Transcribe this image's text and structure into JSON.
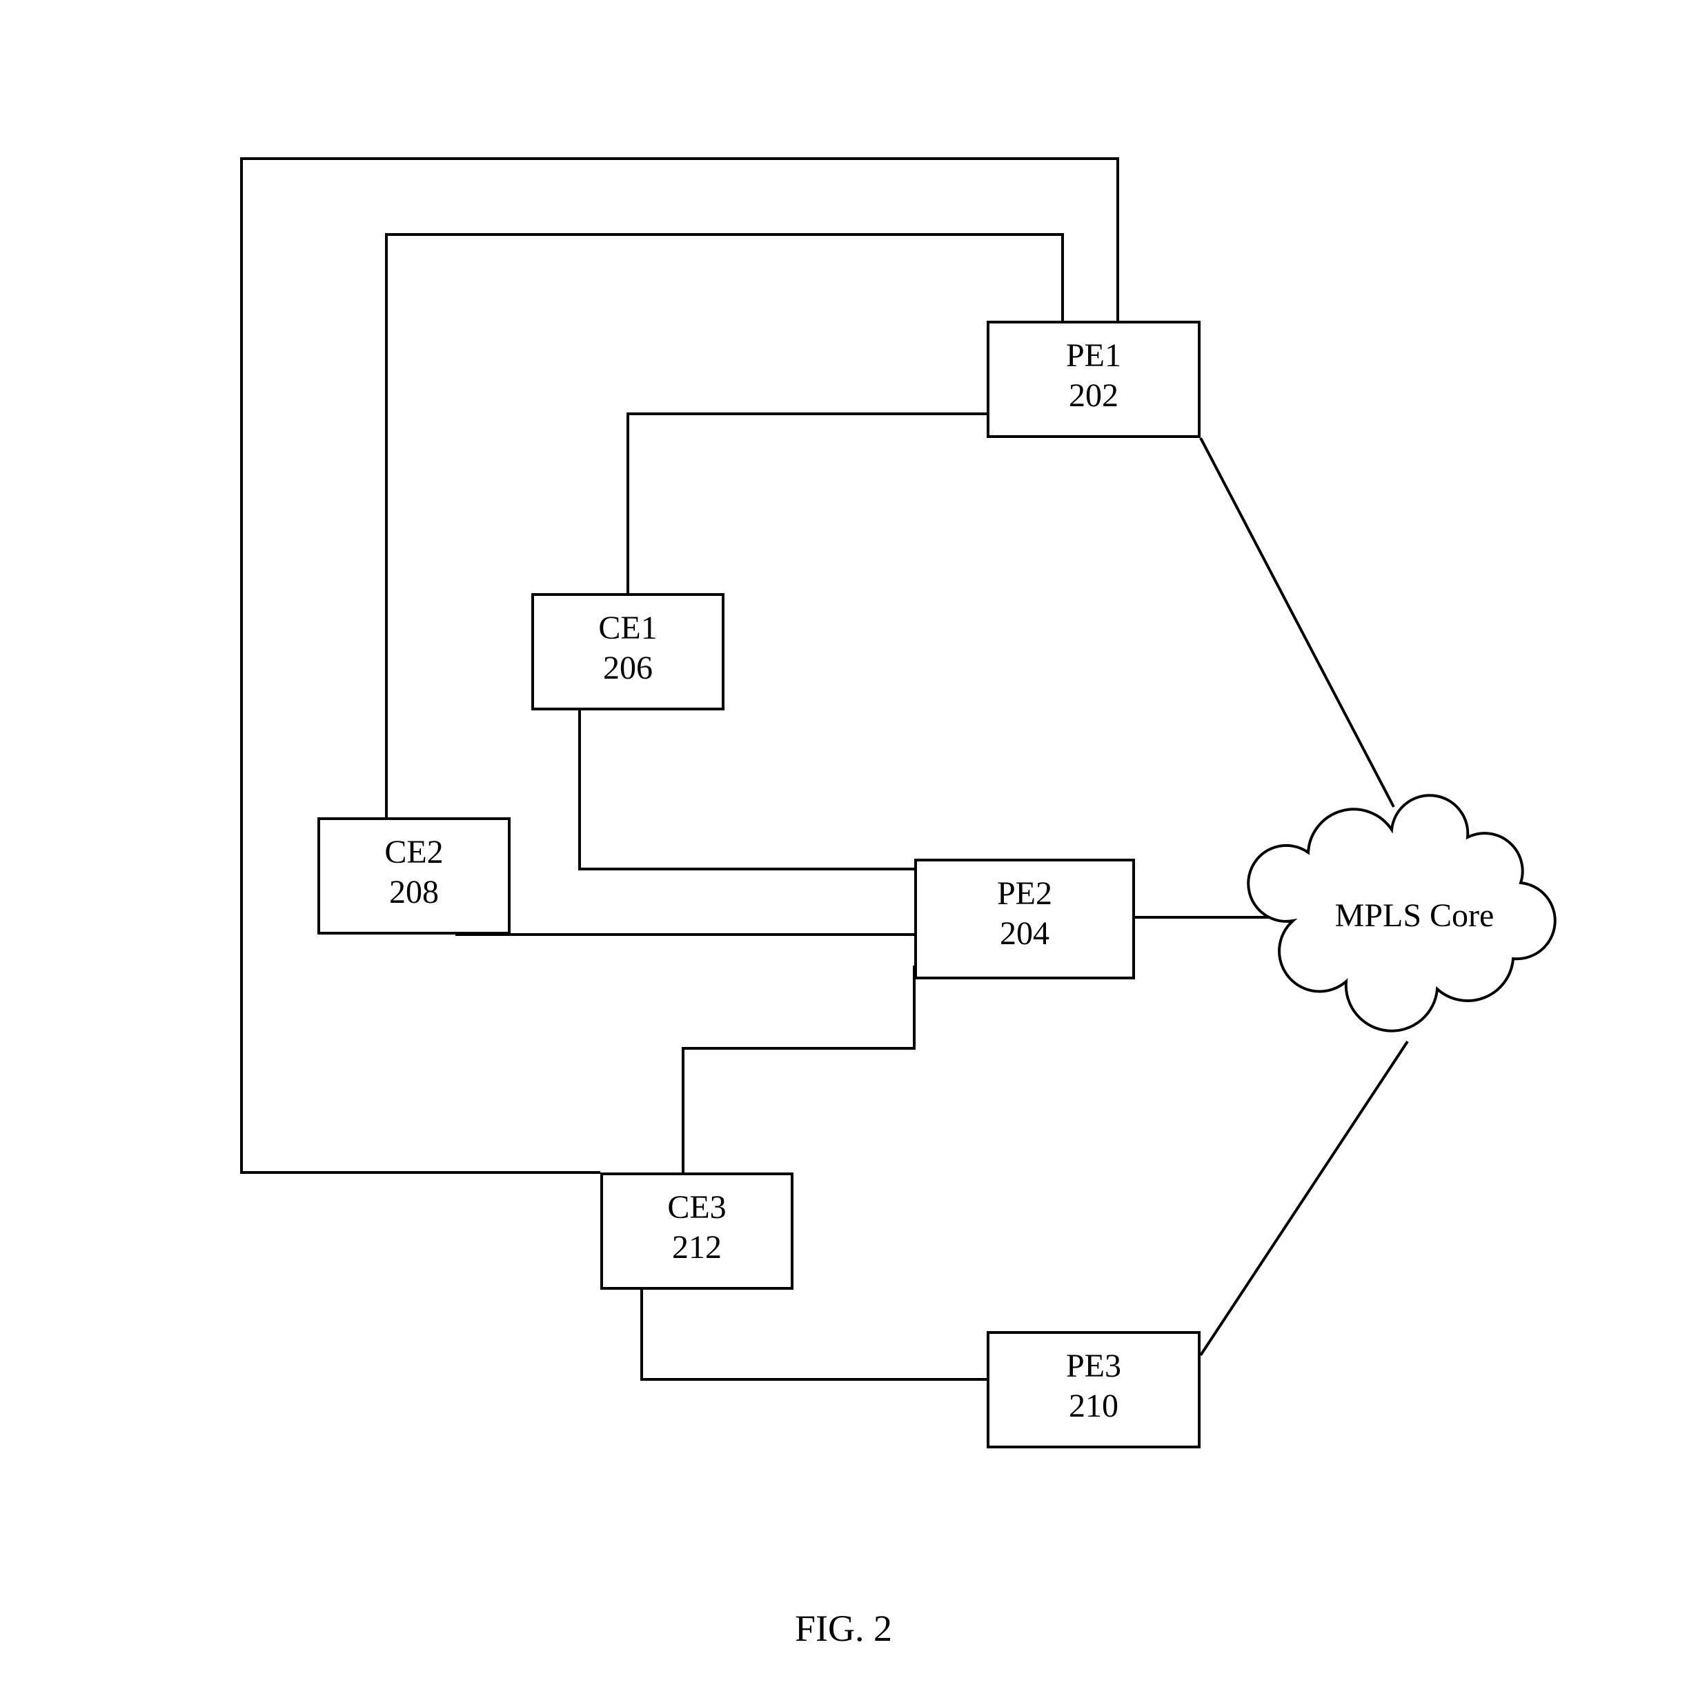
{
  "figure": {
    "caption": "FIG. 2"
  },
  "nodes": {
    "pe1": {
      "name": "PE1",
      "num": "202"
    },
    "pe2": {
      "name": "PE2",
      "num": "204"
    },
    "ce1": {
      "name": "CE1",
      "num": "206"
    },
    "ce2": {
      "name": "CE2",
      "num": "208"
    },
    "pe3": {
      "name": "PE3",
      "num": "210"
    },
    "ce3": {
      "name": "CE3",
      "num": "212"
    },
    "core": {
      "label": "MPLS Core"
    }
  }
}
